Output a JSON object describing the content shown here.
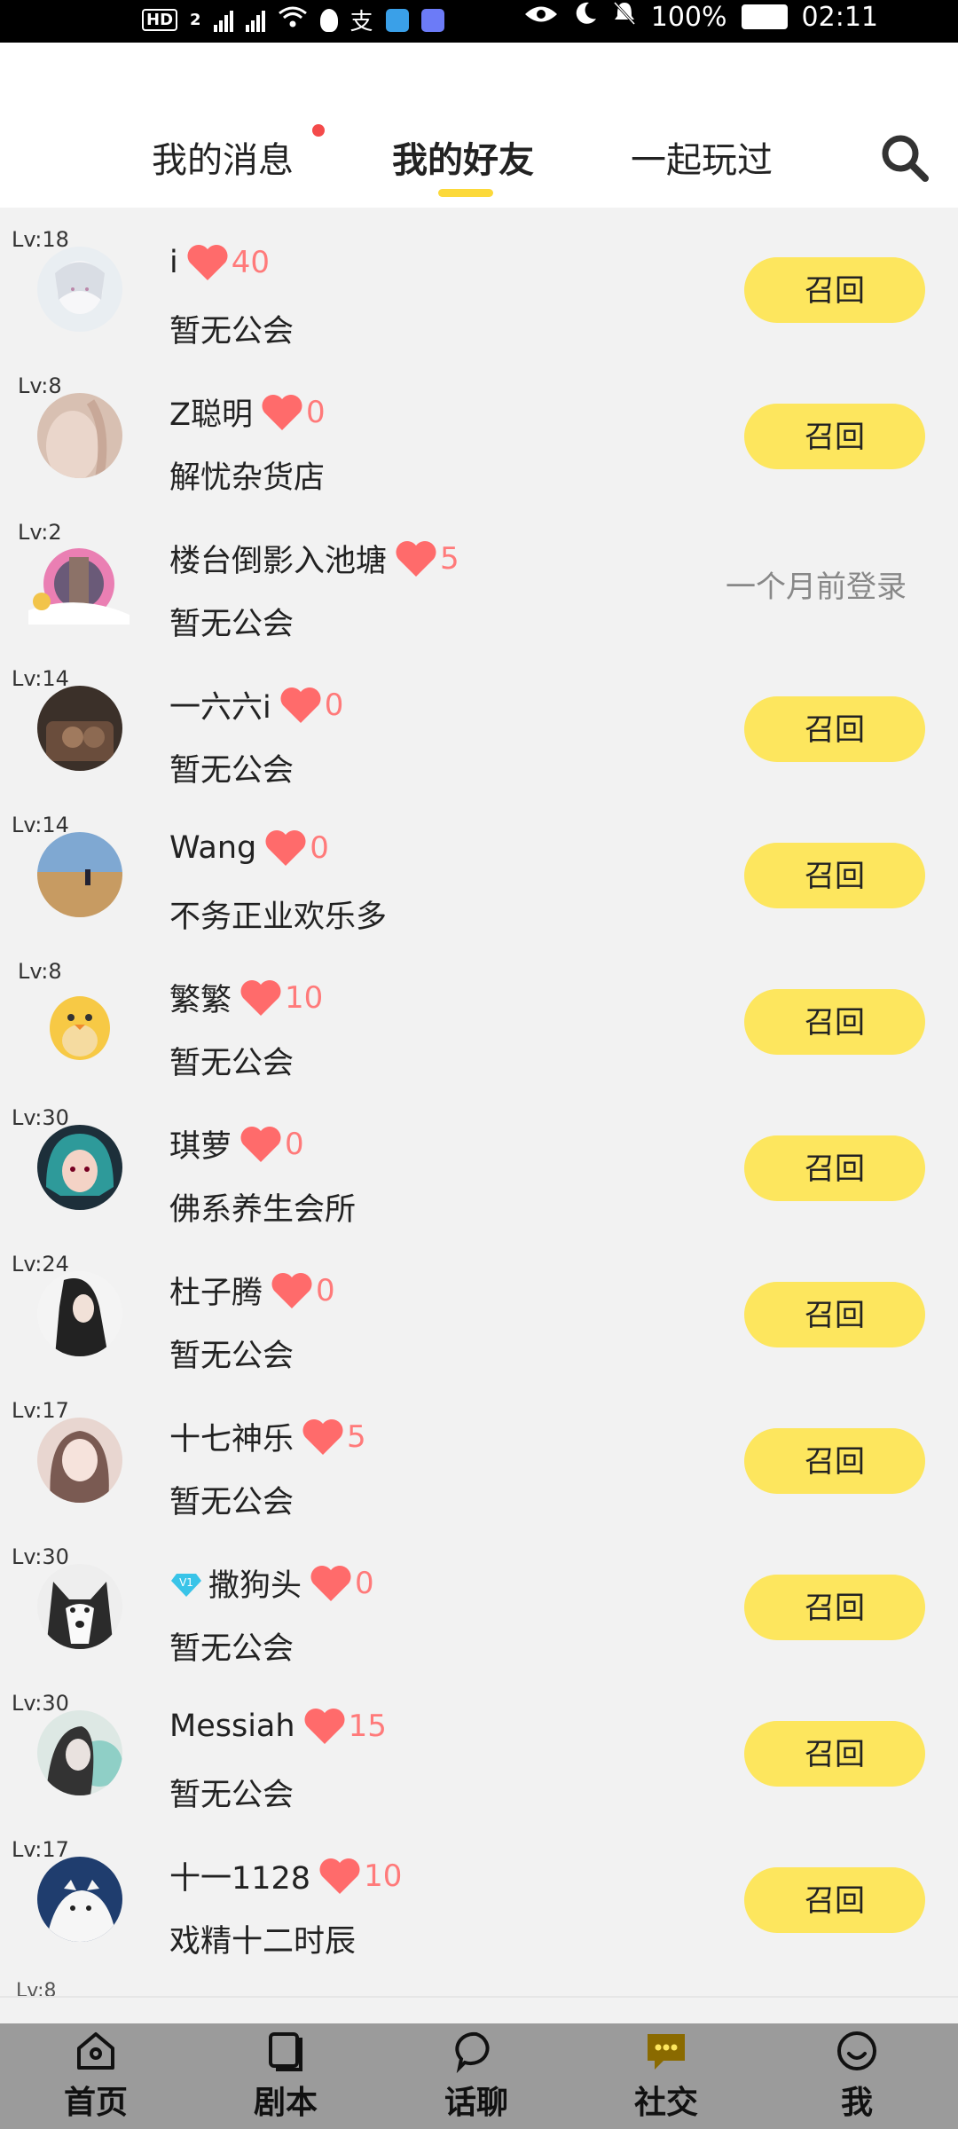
{
  "status_bar": {
    "hd_label": "HD",
    "sim_slot": "2",
    "battery": "100%",
    "time": "02:11"
  },
  "tabs": [
    {
      "label": "我的消息",
      "has_badge": true
    },
    {
      "label": "我的好友",
      "active": true
    },
    {
      "label": "一起玩过"
    }
  ],
  "friends": [
    {
      "level": "Lv:18",
      "name": "i",
      "hearts": "40",
      "guild": "暂无公会",
      "action": "召回"
    },
    {
      "level": "Lv:8",
      "name": "Z聪明",
      "hearts": "0",
      "guild": "解忧杂货店",
      "action": "召回"
    },
    {
      "level": "Lv:2",
      "name": "楼台倒影入池塘",
      "hearts": "5",
      "guild": "暂无公会",
      "last_login": "一个月前登录"
    },
    {
      "level": "Lv:14",
      "name": "一六六i",
      "hearts": "0",
      "guild": "暂无公会",
      "action": "召回"
    },
    {
      "level": "Lv:14",
      "name": "Wang",
      "hearts": "0",
      "guild": "不务正业欢乐多",
      "action": "召回"
    },
    {
      "level": "Lv:8",
      "name": "繁繁",
      "hearts": "10",
      "guild": "暂无公会",
      "action": "召回"
    },
    {
      "level": "Lv:30",
      "name": "琪萝",
      "hearts": "0",
      "guild": "佛系养生会所",
      "action": "召回"
    },
    {
      "level": "Lv:24",
      "name": "杜子腾",
      "hearts": "0",
      "guild": "暂无公会",
      "action": "召回"
    },
    {
      "level": "Lv:17",
      "name": "十七神乐",
      "hearts": "5",
      "guild": "暂无公会",
      "action": "召回"
    },
    {
      "level": "Lv:30",
      "name": "撒狗头",
      "vip": true,
      "hearts": "0",
      "guild": "暂无公会",
      "action": "召回"
    },
    {
      "level": "Lv:30",
      "name": "Messiah",
      "hearts": "15",
      "guild": "暂无公会",
      "action": "召回"
    },
    {
      "level": "Lv:17",
      "name": "十一1128",
      "hearts": "10",
      "guild": "戏精十二时辰",
      "action": "召回"
    }
  ],
  "partial_row_level": "Lv:8",
  "bottom_nav": [
    {
      "label": "首页",
      "icon": "home-icon"
    },
    {
      "label": "剧本",
      "icon": "script-book-icon"
    },
    {
      "label": "话聊",
      "icon": "chat-bubble-icon"
    },
    {
      "label": "社交",
      "icon": "social-message-icon",
      "active": true
    },
    {
      "label": "我",
      "icon": "profile-icon"
    }
  ],
  "colors": {
    "accent_yellow": "#fde65e",
    "heart_red": "#ff6b6b",
    "background": "#f2f2f2",
    "nav_bg": "#9b9b9b"
  }
}
